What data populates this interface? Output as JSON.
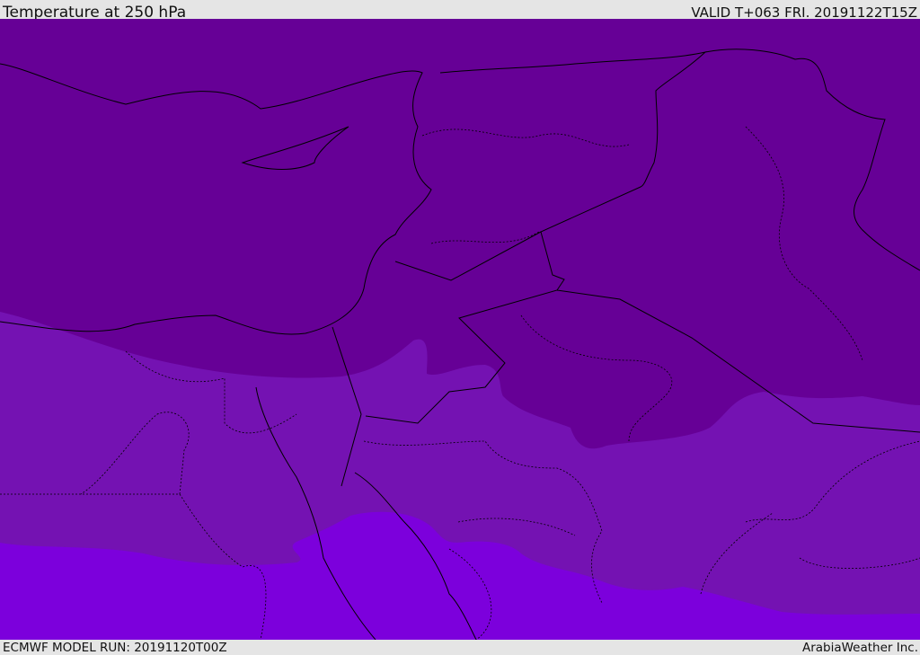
{
  "header": {
    "title": "Temperature at 250 hPa",
    "valid": "VALID T+063 FRI. 20191122T15Z"
  },
  "footer": {
    "model_run": "ECMWF MODEL RUN: 20191120T00Z",
    "credit": "ArabiaWeather Inc."
  },
  "legend_colors": {
    "coldest_band": "#660096",
    "middle_band": "#7412b2",
    "warmest_band": "#7c00dc",
    "coastline": "#000000"
  }
}
